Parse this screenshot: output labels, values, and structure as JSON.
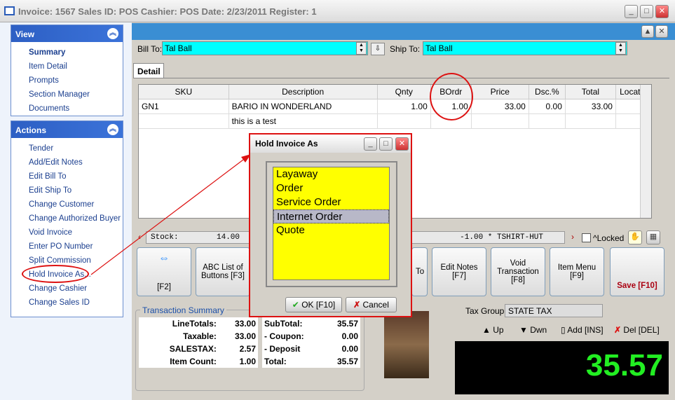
{
  "window": {
    "title": "Invoice: 1567  Sales ID: POS  Cashier: POS  Date:  2/23/2011  Register: 1"
  },
  "sidebar": {
    "view": {
      "title": "View",
      "items": [
        "Summary",
        "Item Detail",
        "Prompts",
        "Section Manager",
        "Documents"
      ]
    },
    "actions": {
      "title": "Actions",
      "items": [
        "Tender",
        "Add/Edit Notes",
        "Edit Bill To",
        "Edit Ship To",
        "Change Customer",
        "Change Authorized Buyer",
        "Void Invoice",
        "Enter PO Number",
        "Split Commission",
        "Hold Invoice As...",
        "Change Cashier",
        "Change Sales ID"
      ]
    }
  },
  "header": {
    "bill_to_label": "Bill To:",
    "bill_to": "Tal Ball",
    "ship_to_label": "Ship To:",
    "ship_to": "Tal Ball"
  },
  "tabs": [
    "Detail"
  ],
  "grid": {
    "columns": [
      "SKU",
      "Description",
      "Qnty",
      "BOrdr",
      "Price",
      "Dsc.%",
      "Total",
      "Locatio"
    ],
    "rows": [
      [
        "GN1",
        "BARIO IN WONDERLAND",
        "1.00",
        "1.00",
        "33.00",
        "0.00",
        "33.00",
        ""
      ],
      [
        "",
        "this is a test",
        "",
        "",
        "",
        "",
        "",
        ""
      ]
    ]
  },
  "stockbar": {
    "stock_label": "Stock:",
    "stock": "14.00",
    "item": "-1.00 * TSHIRT-HUT",
    "locked_label": "^Locked"
  },
  "buttons": {
    "f2": "[F2]",
    "f3": "ABC List of Buttons [F3]",
    "to": "To",
    "f7": "Edit Notes [F7]",
    "f8": "Void Transaction [F8]",
    "f9": "Item Menu [F9]",
    "f10": "Save [F10]"
  },
  "summary": {
    "title": "Transaction Summary",
    "left": [
      [
        "LineTotals:",
        "33.00"
      ],
      [
        "Taxable:",
        "33.00"
      ],
      [
        "SALESTAX:",
        "2.57"
      ],
      [
        "Item Count:",
        "1.00"
      ]
    ],
    "right": [
      [
        "SubTotal:",
        "35.57"
      ],
      [
        "- Coupon:",
        "0.00"
      ],
      [
        "- Deposit",
        "0.00"
      ],
      [
        "Total:",
        "35.57"
      ]
    ]
  },
  "tax": {
    "label": "Tax Group:",
    "value": "STATE TAX"
  },
  "nav": {
    "up": "Up",
    "down": "Dwn",
    "add": "Add [INS]",
    "del": "Del [DEL]"
  },
  "total_display": "35.57",
  "dialog": {
    "title": "Hold Invoice As",
    "options": [
      "Layaway",
      "Order",
      "Service Order",
      "Internet Order",
      "Quote"
    ],
    "selected": "Internet Order",
    "ok": "OK [F10]",
    "cancel": "Cancel"
  },
  "colors": {
    "accent": "#3a8ed3",
    "highlight": "#ffff00",
    "total": "#22ee22",
    "annotation": "#dd1111"
  }
}
